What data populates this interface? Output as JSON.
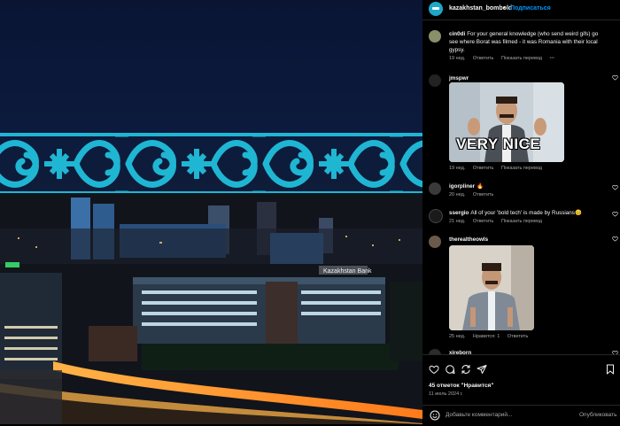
{
  "header": {
    "username": "kazakhstan_bombold",
    "separator": "•",
    "follow_label": "Подписаться"
  },
  "comments": [
    {
      "username": "cin0di",
      "text": "For your general knowledge (who send weird gifs) go see where Borat was filmed - it was Romania with their local gypsy.",
      "time": "19 нед.",
      "reply": "Ответить",
      "translate": "Показать перевод",
      "more": "···"
    },
    {
      "username": "jmspwr",
      "gif_text": "VERY NICE",
      "time": "19 нед.",
      "reply": "Ответить",
      "translate": "Показать перевод"
    },
    {
      "username": "igorpliner",
      "text": "🔥",
      "time": "20 нед.",
      "reply": "Ответить"
    },
    {
      "username": "ssergio",
      "text": "All of your 'bold tech' is made by Russians😊",
      "time": "21 нед.",
      "reply": "Ответить",
      "translate": "Показать перевод"
    },
    {
      "username": "therealtheowls",
      "time": "25 нед.",
      "likes": "Нравится: 1",
      "reply": "Ответить"
    },
    {
      "username": "xireborn"
    }
  ],
  "post": {
    "likes_text": "45 отметок \"Нравится\"",
    "date_text": "11 июль 2024 г.",
    "add_comment_placeholder": "Добавьте комментарий...",
    "publish_label": "Опубликовать",
    "building_sign": "Kazakhstan Bank"
  },
  "colors": {
    "ornament": "#1fb6d3",
    "accent": "#0095f6",
    "panel_bg": "#000000",
    "muted_text": "#a8a8a8"
  },
  "icons": [
    "heart-icon",
    "comment-icon",
    "share-icon",
    "send-icon",
    "bookmark-icon",
    "smile-icon"
  ]
}
